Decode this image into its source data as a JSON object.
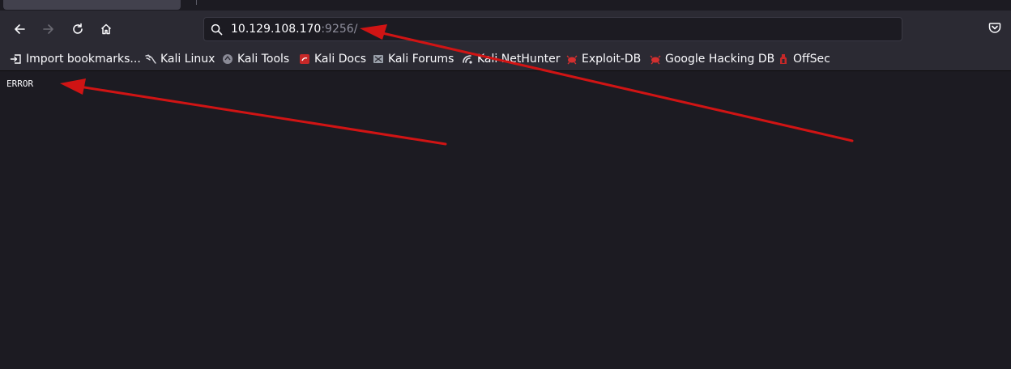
{
  "browser": {
    "url_host": "10.129.108.170",
    "url_port": ":9256/",
    "nav": {
      "back": "back-arrow-icon",
      "forward": "forward-arrow-icon",
      "reload": "reload-icon",
      "home": "home-icon",
      "pocket": "pocket-icon"
    }
  },
  "bookmarks": [
    {
      "label": "Import bookmarks...",
      "icon": "import-icon"
    },
    {
      "label": "Kali Linux",
      "icon": "kali-dragon-icon"
    },
    {
      "label": "Kali Tools",
      "icon": "kali-tools-icon"
    },
    {
      "label": "Kali Docs",
      "icon": "kali-docs-icon"
    },
    {
      "label": "Kali Forums",
      "icon": "kali-forums-icon"
    },
    {
      "label": "Kali NetHunter",
      "icon": "kali-nethunter-icon"
    },
    {
      "label": "Exploit-DB",
      "icon": "exploit-db-icon"
    },
    {
      "label": "Google Hacking DB",
      "icon": "ghdb-icon"
    },
    {
      "label": "OffSec",
      "icon": "offsec-icon"
    }
  ],
  "page": {
    "body_text": "ERROR"
  },
  "colors": {
    "annotation_arrow": "#d01414",
    "chrome": "#2b2a33",
    "page_bg": "#1c1b22"
  }
}
